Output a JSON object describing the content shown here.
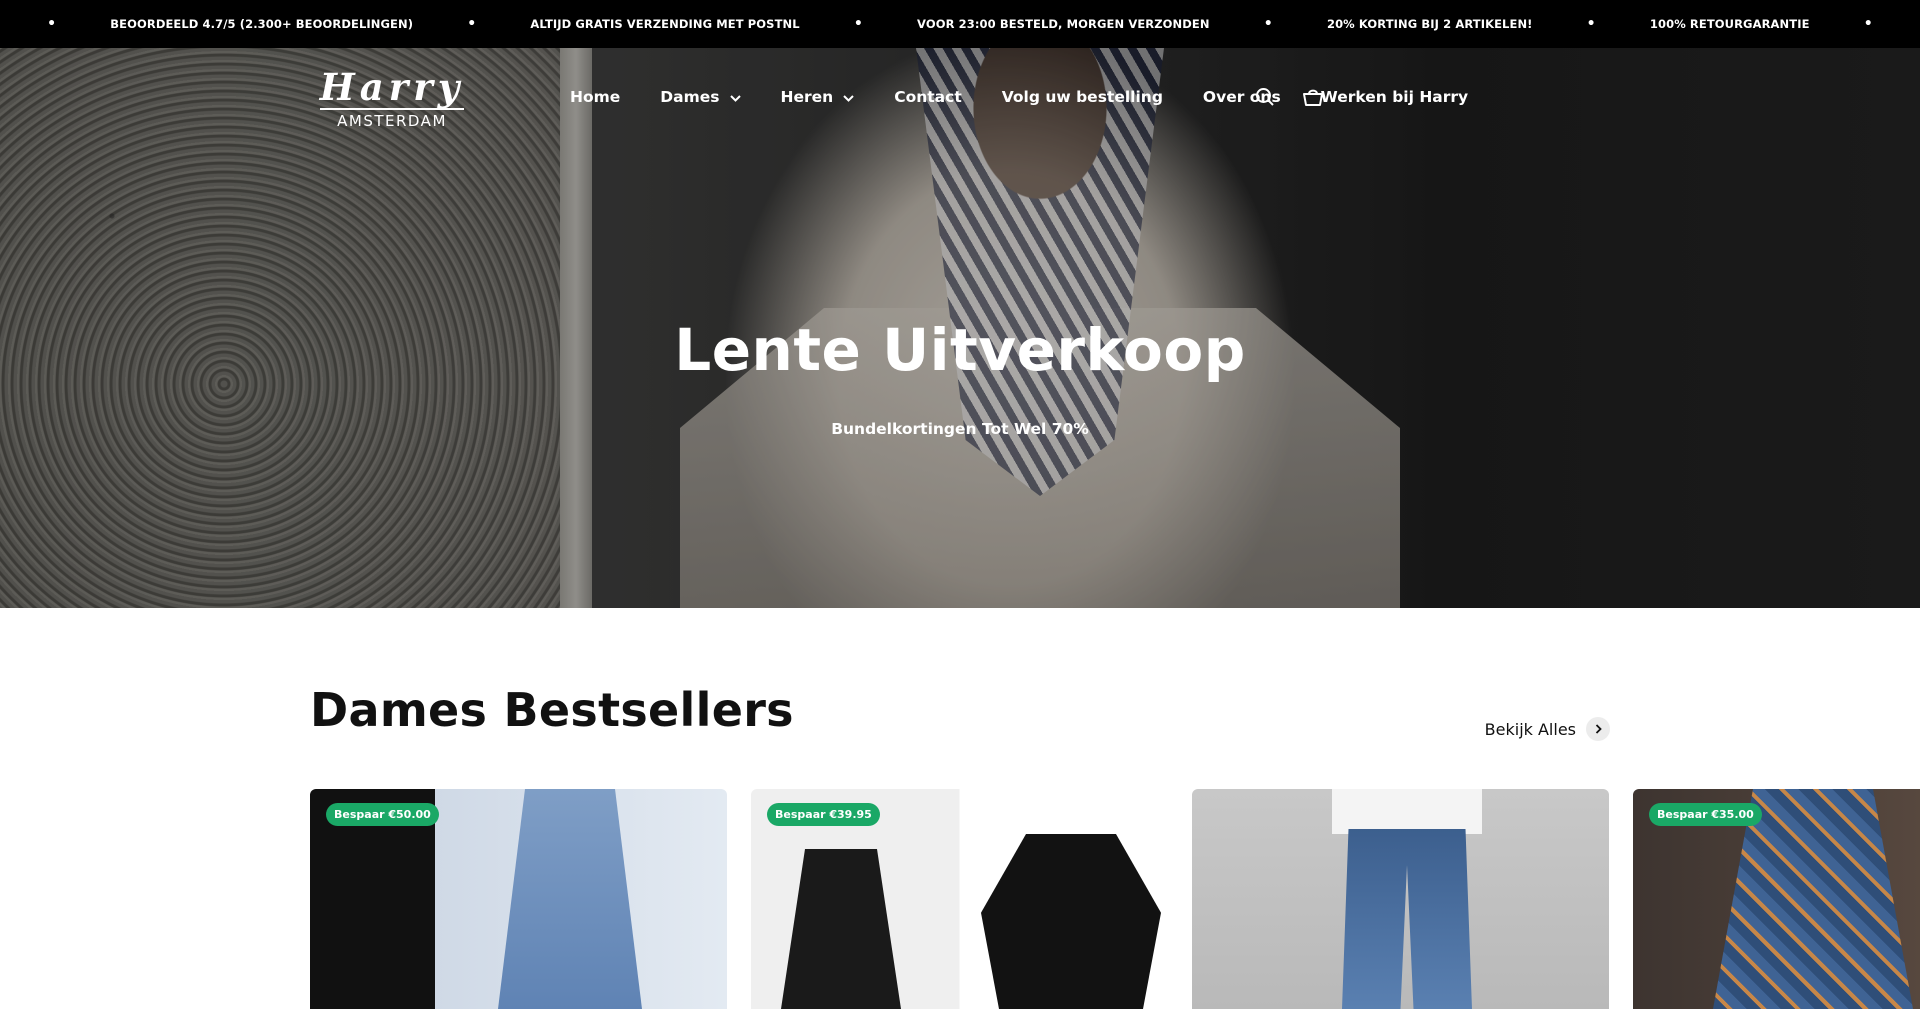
{
  "announcement_bar": {
    "items": [
      "BEOORDEELD 4.7/5 (2.300+ BEOORDELINGEN)",
      "ALTIJD GRATIS VERZENDING MET POSTNL",
      "VOOR 23:00 BESTELD, MORGEN VERZONDEN",
      "20% KORTING BIJ 2 ARTIKELEN!",
      "100% RETOURGARANTIE"
    ]
  },
  "header": {
    "logo_line1": "Harry",
    "logo_line2": "AMSTERDAM",
    "nav": [
      {
        "label": "Home",
        "dropdown": false
      },
      {
        "label": "Dames",
        "dropdown": true
      },
      {
        "label": "Heren",
        "dropdown": true
      },
      {
        "label": "Contact",
        "dropdown": false
      },
      {
        "label": "Volg uw bestelling",
        "dropdown": false
      },
      {
        "label": "Over ons",
        "dropdown": false
      },
      {
        "label": "Werken bij Harry",
        "dropdown": false
      }
    ],
    "icons": [
      "search-icon",
      "cart-icon"
    ]
  },
  "hero": {
    "title": "Lente Uitverkoop",
    "subtitle": "Bundelkortingen Tot Wel 70%"
  },
  "section": {
    "title": "Dames Bestsellers",
    "view_all": "Bekijk Alles"
  },
  "products": [
    {
      "badge": "Bespaar €50.00"
    },
    {
      "badge": "Bespaar €39.95"
    },
    {
      "badge": ""
    },
    {
      "badge": "Bespaar €35.00"
    }
  ],
  "colors": {
    "announcement_bg": "#000000",
    "badge_green": "#1aa866",
    "text_dark": "#111111"
  }
}
